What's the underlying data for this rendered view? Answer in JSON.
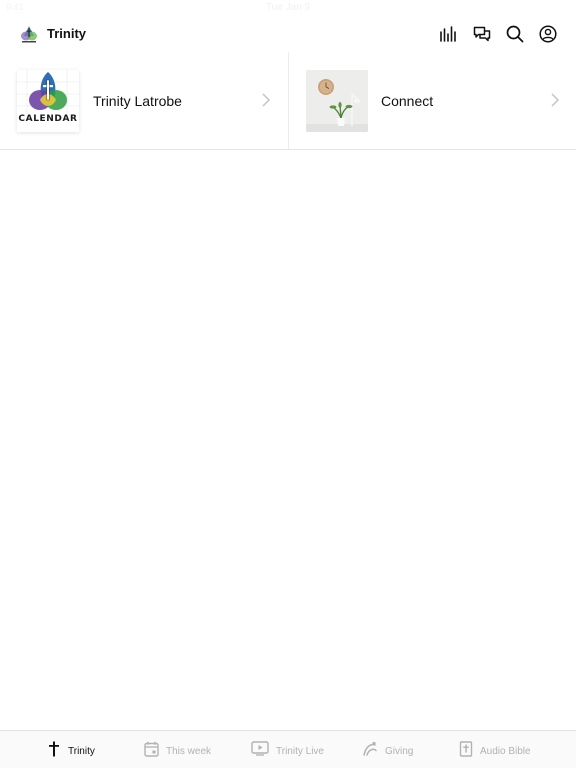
{
  "status_bar": {
    "time": "9:41",
    "date": "Tue Jan 9"
  },
  "header": {
    "title": "Trinity",
    "logo_icon": "trinity-logo-icon",
    "actions": [
      "equalizer-icon",
      "chat-icon",
      "search-icon",
      "account-icon"
    ]
  },
  "cards": [
    {
      "title": "Trinity Latrobe",
      "thumb_text": "CALENDAR",
      "thumb_icon": "trinity-calendar-logo"
    },
    {
      "title": "Connect",
      "thumb_icon": "clock-and-plant-photo"
    }
  ],
  "tabbar": {
    "items": [
      {
        "label": "Trinity",
        "icon": "cross-icon",
        "active": true
      },
      {
        "label": "This week",
        "icon": "calendar-icon",
        "active": false
      },
      {
        "label": "Trinity Live",
        "icon": "video-icon",
        "active": false
      },
      {
        "label": "Giving",
        "icon": "giving-icon",
        "active": false
      },
      {
        "label": "Audio Bible",
        "icon": "bible-icon",
        "active": false
      }
    ]
  },
  "colors": {
    "text": "#111111",
    "inactive": "#b2b2b2",
    "divider": "#e6e6e6",
    "tab_bg": "#fafafa"
  }
}
